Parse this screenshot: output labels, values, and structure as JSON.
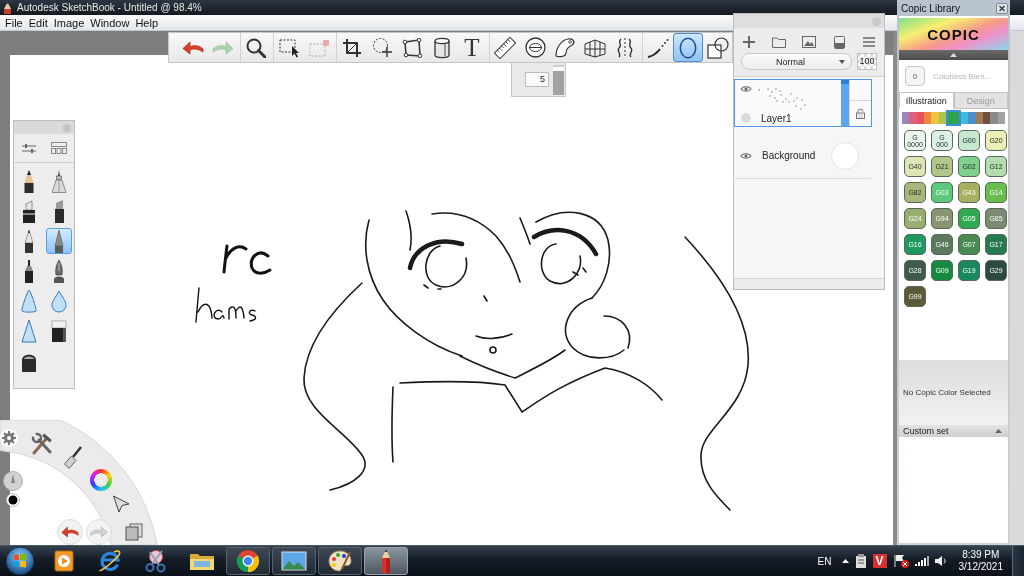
{
  "title_bar": {
    "title": "Autodesk SketchBook - Untitled @ 98.4%"
  },
  "menu_bar": {
    "items": [
      "File",
      "Edit",
      "Image",
      "Window",
      "Help"
    ]
  },
  "toolbar": {
    "groups": [
      {
        "tools": [
          {
            "kind": "undo",
            "selected": false,
            "disabled": false
          },
          {
            "kind": "redo",
            "selected": false,
            "disabled": true
          }
        ]
      },
      {
        "tools": [
          {
            "kind": "zoom",
            "selected": false,
            "disabled": false
          }
        ]
      },
      {
        "tools": [
          {
            "kind": "select",
            "selected": false,
            "disabled": false
          },
          {
            "kind": "transform",
            "selected": false,
            "disabled": true
          }
        ]
      },
      {
        "tools": [
          {
            "kind": "crop",
            "selected": false,
            "disabled": false
          },
          {
            "kind": "lasso_move",
            "selected": false,
            "disabled": false
          },
          {
            "kind": "distort",
            "selected": false,
            "disabled": false
          },
          {
            "kind": "fill",
            "selected": false,
            "disabled": false
          },
          {
            "kind": "text",
            "glyph": "T",
            "selected": false,
            "disabled": false
          }
        ]
      },
      {
        "tools": [
          {
            "kind": "ruler",
            "selected": false,
            "disabled": false
          },
          {
            "kind": "ellipse_guide",
            "selected": false,
            "disabled": false
          },
          {
            "kind": "french_curve",
            "selected": false,
            "disabled": false
          },
          {
            "kind": "perspective",
            "selected": false,
            "disabled": false
          },
          {
            "kind": "symmetry",
            "selected": false,
            "disabled": false
          }
        ]
      },
      {
        "tools": [
          {
            "kind": "stroke",
            "selected": false,
            "disabled": false
          },
          {
            "kind": "ellipse",
            "selected": true,
            "disabled": false
          },
          {
            "kind": "shapes",
            "selected": false,
            "disabled": false
          }
        ]
      }
    ]
  },
  "size_popup": {
    "value": "5",
    "level": 0.92
  },
  "layers_panel": {
    "blend_mode": "Normal",
    "opacity": "100",
    "layers": [
      {
        "kind": "paint",
        "name": "Layer1",
        "selected": true,
        "visible": true
      },
      {
        "kind": "background",
        "name": "Background",
        "selected": false,
        "visible": true
      }
    ]
  },
  "brush_palette": {
    "brushes": [
      {
        "kind": "pencil",
        "selected": false
      },
      {
        "kind": "technical_pen",
        "selected": false
      },
      {
        "kind": "marker",
        "selected": false
      },
      {
        "kind": "chisel_marker",
        "selected": false
      },
      {
        "kind": "ballpoint",
        "selected": false
      },
      {
        "kind": "fine_pen",
        "selected": true
      },
      {
        "kind": "felt_pen",
        "selected": false
      },
      {
        "kind": "fountain_pen",
        "selected": false
      },
      {
        "kind": "soft_cone",
        "selected": false
      },
      {
        "kind": "drop",
        "selected": false
      },
      {
        "kind": "cone",
        "selected": false
      },
      {
        "kind": "eraser",
        "selected": false
      },
      {
        "kind": "hard_eraser",
        "selected": false
      }
    ]
  },
  "copic_library": {
    "title": "Copic Library",
    "logo": "COPIC",
    "blender": {
      "code": "0",
      "label": "Colorless Blen..."
    },
    "tabs": [
      {
        "label": "Illustration",
        "selected": true
      },
      {
        "label": "Design",
        "selected": false
      }
    ],
    "families": [
      {
        "color": "#9b86c0",
        "selected": false
      },
      {
        "color": "#e0607f",
        "selected": false
      },
      {
        "color": "#e8525a",
        "selected": false
      },
      {
        "color": "#f08440",
        "selected": false
      },
      {
        "color": "#f2c23e",
        "selected": false
      },
      {
        "color": "#a9c64e",
        "selected": false
      },
      {
        "color": "#2fa24e",
        "selected": true
      },
      {
        "color": "#3fb9df",
        "selected": false
      },
      {
        "color": "#4f8fc8",
        "selected": false
      },
      {
        "color": "#a27a52",
        "selected": false
      },
      {
        "color": "#6f4f3e",
        "selected": false
      },
      {
        "color": "#8a8a8a",
        "selected": false
      },
      {
        "color": "#a2a2a2",
        "selected": false
      }
    ],
    "swatches": [
      {
        "label": "G\n0000",
        "color": "#e9f6ee"
      },
      {
        "label": "G\n000",
        "color": "#dcf1e3"
      },
      {
        "label": "G00",
        "color": "#c4e9cf"
      },
      {
        "label": "G20",
        "color": "#edf0b6"
      },
      {
        "label": "G40",
        "color": "#dfe6b6"
      },
      {
        "label": "G21",
        "color": "#b2c68a"
      },
      {
        "label": "G02",
        "color": "#7ed08f"
      },
      {
        "label": "G12",
        "color": "#b4dcae"
      },
      {
        "label": "G82",
        "color": "#a8b87c"
      },
      {
        "label": "G03",
        "color": "#5cc87c"
      },
      {
        "label": "G43",
        "color": "#a8b060"
      },
      {
        "label": "G14",
        "color": "#68bd4c"
      },
      {
        "label": "G24",
        "color": "#98ae6e"
      },
      {
        "label": "G94",
        "color": "#889570"
      },
      {
        "label": "G05",
        "color": "#2faa4f"
      },
      {
        "label": "G85",
        "color": "#7c8a72"
      },
      {
        "label": "G16",
        "color": "#1e9a60"
      },
      {
        "label": "G46",
        "color": "#5b7a5c"
      },
      {
        "label": "G07",
        "color": "#4a8a52"
      },
      {
        "label": "G17",
        "color": "#277a4f"
      },
      {
        "label": "G28",
        "color": "#3d5a4a"
      },
      {
        "label": "G09",
        "color": "#17893f"
      },
      {
        "label": "G19",
        "color": "#17895c"
      },
      {
        "label": "G29",
        "color": "#2d4a40"
      },
      {
        "label": "G99",
        "color": "#5a5a38"
      }
    ],
    "status": "No Copic Color Selected",
    "custom_set": "Custom set"
  },
  "taskbar": {
    "apps": [
      {
        "kind": "media_player",
        "running": false,
        "selected": false
      },
      {
        "kind": "browser_e",
        "running": false,
        "selected": false
      },
      {
        "kind": "snipping",
        "running": false,
        "selected": false
      },
      {
        "kind": "folder",
        "running": false,
        "selected": false
      },
      {
        "kind": "browser_round",
        "running": true,
        "selected": false
      },
      {
        "kind": "photo_viewer",
        "running": true,
        "selected": false
      },
      {
        "kind": "paint",
        "running": true,
        "selected": false
      },
      {
        "kind": "sketch_app",
        "running": true,
        "selected": true
      }
    ]
  },
  "system_tray": {
    "language": "EN",
    "badge": "V",
    "time": "8:39 PM",
    "date": "3/12/2021"
  }
}
